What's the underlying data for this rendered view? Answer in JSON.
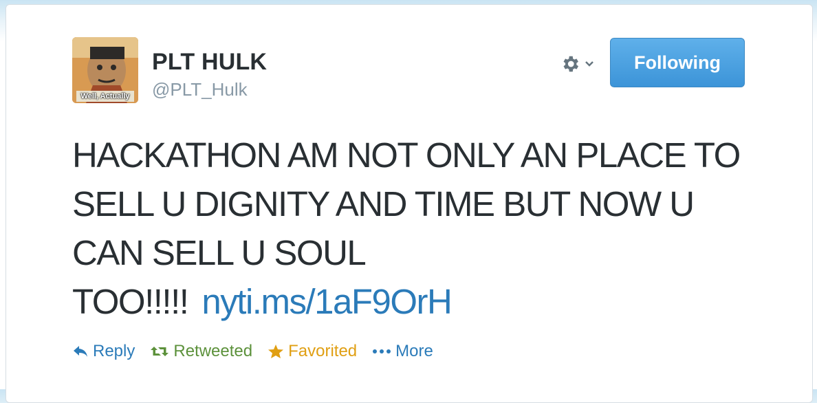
{
  "user": {
    "name": "PLT HULK",
    "handle": "@PLT_Hulk",
    "avatar_caption": "Well, Actually"
  },
  "follow_button": {
    "label": "Following"
  },
  "tweet": {
    "text": "HACKATHON AM NOT ONLY AN PLACE TO SELL U DIGNITY AND TIME BUT NOW U CAN SELL U SOUL TOO!!!!!",
    "link": "nyti.ms/1aF9OrH"
  },
  "actions": {
    "reply": "Reply",
    "retweeted": "Retweeted",
    "favorited": "Favorited",
    "more": "More"
  },
  "colors": {
    "link": "#2b7bb9",
    "retweeted": "#5c913b",
    "favorited": "#e09f13",
    "follow_button": "#3c94d8"
  },
  "icons": [
    "gear-icon",
    "chevron-down-icon",
    "reply-icon",
    "retweet-icon",
    "star-icon",
    "more-dots-icon"
  ]
}
